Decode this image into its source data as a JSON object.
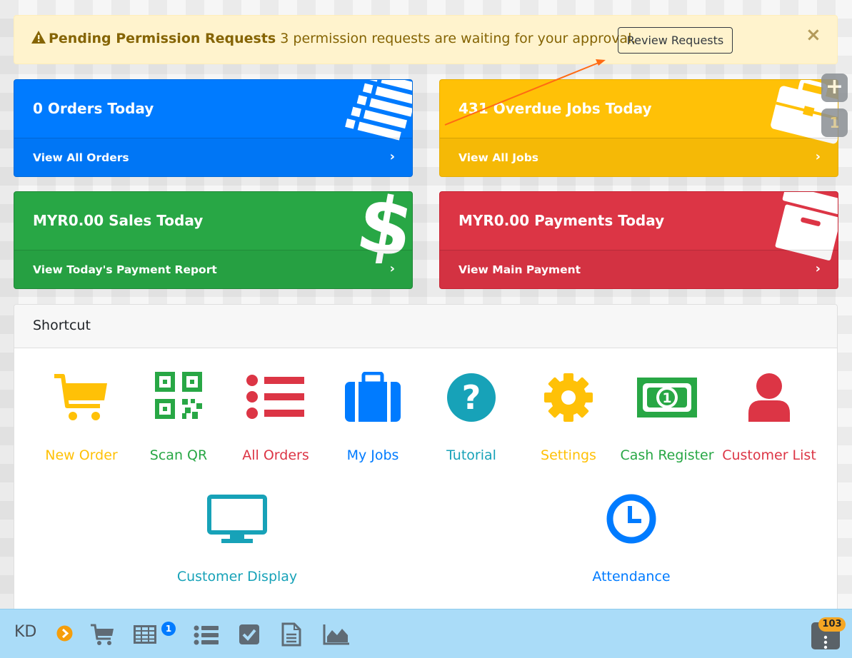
{
  "alert": {
    "title": "Pending Permission Requests",
    "message": "3 permission requests are waiting for your approval.",
    "button_label": "Review Requests",
    "close_label": "×",
    "icon": "warning-triangle-icon"
  },
  "cards": {
    "orders": {
      "title": "0 Orders Today",
      "link": "View All Orders",
      "chevron": "›",
      "icon": "list-icon",
      "color": "#007bff"
    },
    "jobs": {
      "title": "431 Overdue Jobs Today",
      "link": "View All Jobs",
      "chevron": "›",
      "icon": "briefcase-icon",
      "color": "#ffc107"
    },
    "sales": {
      "title": "MYR0.00 Sales Today",
      "link": "View Today's Payment Report",
      "chevron": "›",
      "icon": "dollar-icon",
      "color": "#28a745"
    },
    "payments": {
      "title": "MYR0.00 Payments Today",
      "link": "View Main Payment",
      "chevron": "›",
      "icon": "archive-box-icon",
      "color": "#dc3545"
    }
  },
  "floating": {
    "plus": "+",
    "count": "1"
  },
  "shortcut": {
    "title": "Shortcut",
    "items": [
      {
        "label": "New Order",
        "icon": "cart-icon",
        "color": "#ffc107"
      },
      {
        "label": "Scan QR",
        "icon": "qr-code-icon",
        "color": "#28a745"
      },
      {
        "label": "All Orders",
        "icon": "list-icon",
        "color": "#dc3545"
      },
      {
        "label": "My Jobs",
        "icon": "briefcase-icon",
        "color": "#007bff"
      },
      {
        "label": "Tutorial",
        "icon": "question-circle-icon",
        "color": "#17a2b8"
      },
      {
        "label": "Settings",
        "icon": "gear-icon",
        "color": "#ffc107"
      },
      {
        "label": "Cash Register",
        "icon": "money-bill-icon",
        "color": "#28a745"
      },
      {
        "label": "Customer List",
        "icon": "user-icon",
        "color": "#dc3545"
      },
      {
        "label": "Customer Display",
        "icon": "monitor-icon",
        "color": "#17a2b8"
      },
      {
        "label": "Attendance",
        "icon": "clock-icon",
        "color": "#007bff"
      }
    ]
  },
  "bottom_bar": {
    "initials": "KD",
    "table_badge": "1",
    "menu_badge": "103",
    "icons": [
      "chevron-circle-right-icon",
      "cart-icon",
      "table-icon",
      "list-icon",
      "check-square-icon",
      "document-icon",
      "area-chart-icon",
      "vertical-dots-icon"
    ]
  }
}
